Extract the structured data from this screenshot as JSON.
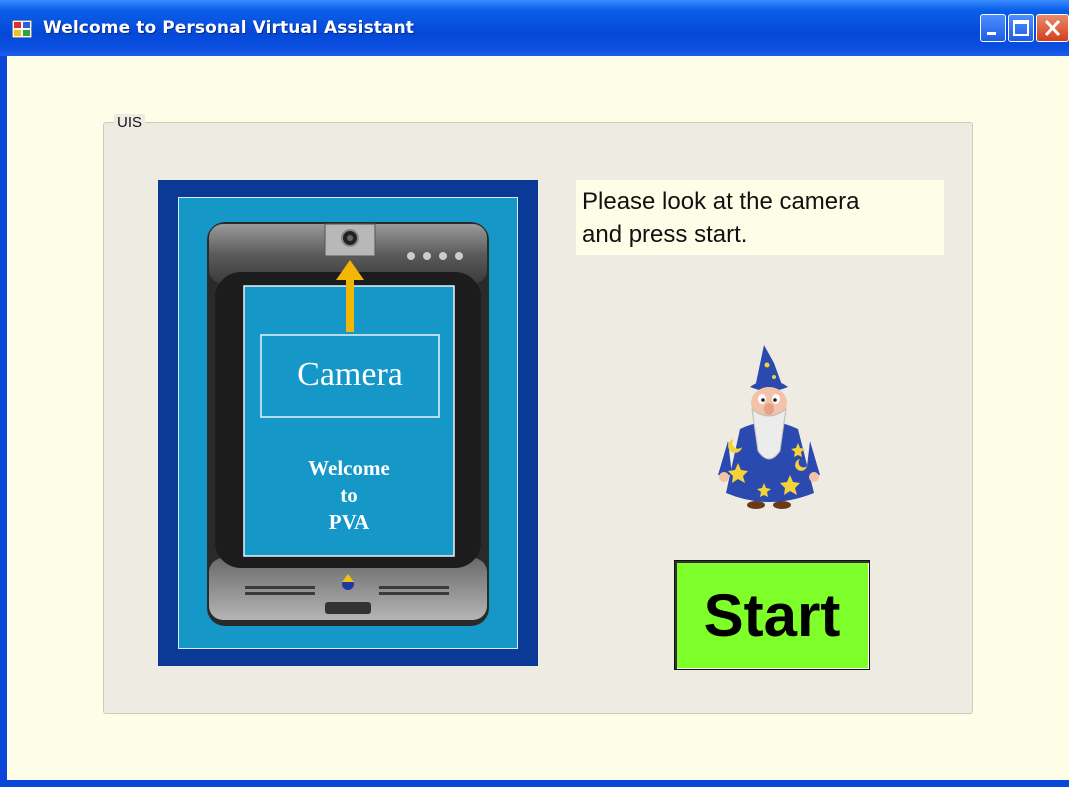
{
  "window": {
    "title": "Welcome to Personal Virtual Assistant",
    "icon": "app-window-icon",
    "controls": [
      "minimize-icon",
      "maximize-icon",
      "close-icon"
    ]
  },
  "group": {
    "label": "UIS"
  },
  "device": {
    "camera_label": "Camera",
    "welcome_line1": "Welcome",
    "welcome_line2": "to",
    "welcome_line3": "PVA",
    "frame_color": "#0a3a96",
    "screen_color": "#1597c8",
    "arrow_color": "#f2b705"
  },
  "prompt": {
    "line1": "Please look at the camera",
    "line2": "and press start."
  },
  "start_button": {
    "label": "Start",
    "color": "#7fff2a"
  },
  "assistant": {
    "icon": "wizard-icon"
  }
}
